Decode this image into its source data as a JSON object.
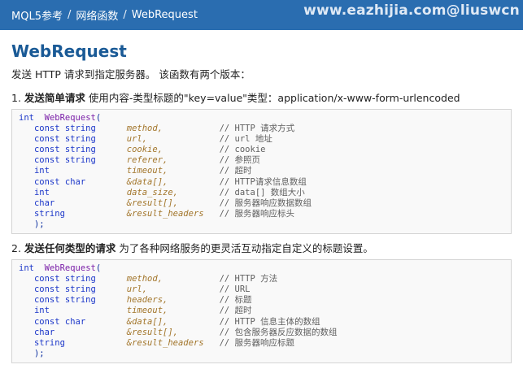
{
  "breadcrumb": [
    "MQL5参考",
    "网络函数",
    "WebRequest"
  ],
  "watermark": "www.eazhijia.com@liuswcn",
  "title": "WebRequest",
  "intro": "发送 HTTP 请求到指定服务器。 该函数有两个版本：",
  "section1": {
    "number": "1.",
    "title": "发送简单请求",
    "desc": "使用内容-类型标题的\"key=value\"类型：application/x-www-form-urlencoded"
  },
  "code1": {
    "ret": "int",
    "fn": "WebRequest",
    "params": [
      {
        "type": "const string",
        "name": "method",
        "sep": ",",
        "comment": "// HTTP 请求方式"
      },
      {
        "type": "const string",
        "name": "url",
        "sep": ",",
        "comment": "// url 地址"
      },
      {
        "type": "const string",
        "name": "cookie",
        "sep": ",",
        "comment": "// cookie"
      },
      {
        "type": "const string",
        "name": "referer",
        "sep": ",",
        "comment": "// 参照页"
      },
      {
        "type": "int",
        "name": "timeout",
        "sep": ",",
        "comment": "// 超时"
      },
      {
        "type": "const char",
        "name": "&data[]",
        "sep": ",",
        "comment": "// HTTP请求信息数组"
      },
      {
        "type": "int",
        "name": "data_size",
        "sep": ",",
        "comment": "// data[] 数组大小"
      },
      {
        "type": "char",
        "name": "&result[]",
        "sep": ",",
        "comment": "// 服务器响应数据数组"
      },
      {
        "type": "string",
        "name": "&result_headers",
        "sep": "",
        "comment": "// 服务器响应标头"
      }
    ]
  },
  "section2": {
    "number": "2.",
    "title": "发送任何类型的请求",
    "desc": "为了各种网络服务的更灵活互动指定自定义的标题设置。"
  },
  "code2": {
    "ret": "int",
    "fn": "WebRequest",
    "params": [
      {
        "type": "const string",
        "name": "method",
        "sep": ",",
        "comment": "// HTTP 方法"
      },
      {
        "type": "const string",
        "name": "url",
        "sep": ",",
        "comment": "// URL"
      },
      {
        "type": "const string",
        "name": "headers",
        "sep": ",",
        "comment": "// 标题"
      },
      {
        "type": "int",
        "name": "timeout",
        "sep": ",",
        "comment": "// 超时"
      },
      {
        "type": "const char",
        "name": "&data[]",
        "sep": ",",
        "comment": "// HTTP 信息主体的数组"
      },
      {
        "type": "char",
        "name": "&result[]",
        "sep": ",",
        "comment": "// 包含服务器反应数据的数组"
      },
      {
        "type": "string",
        "name": "&result_headers",
        "sep": "",
        "comment": "// 服务器响应标题"
      }
    ]
  }
}
